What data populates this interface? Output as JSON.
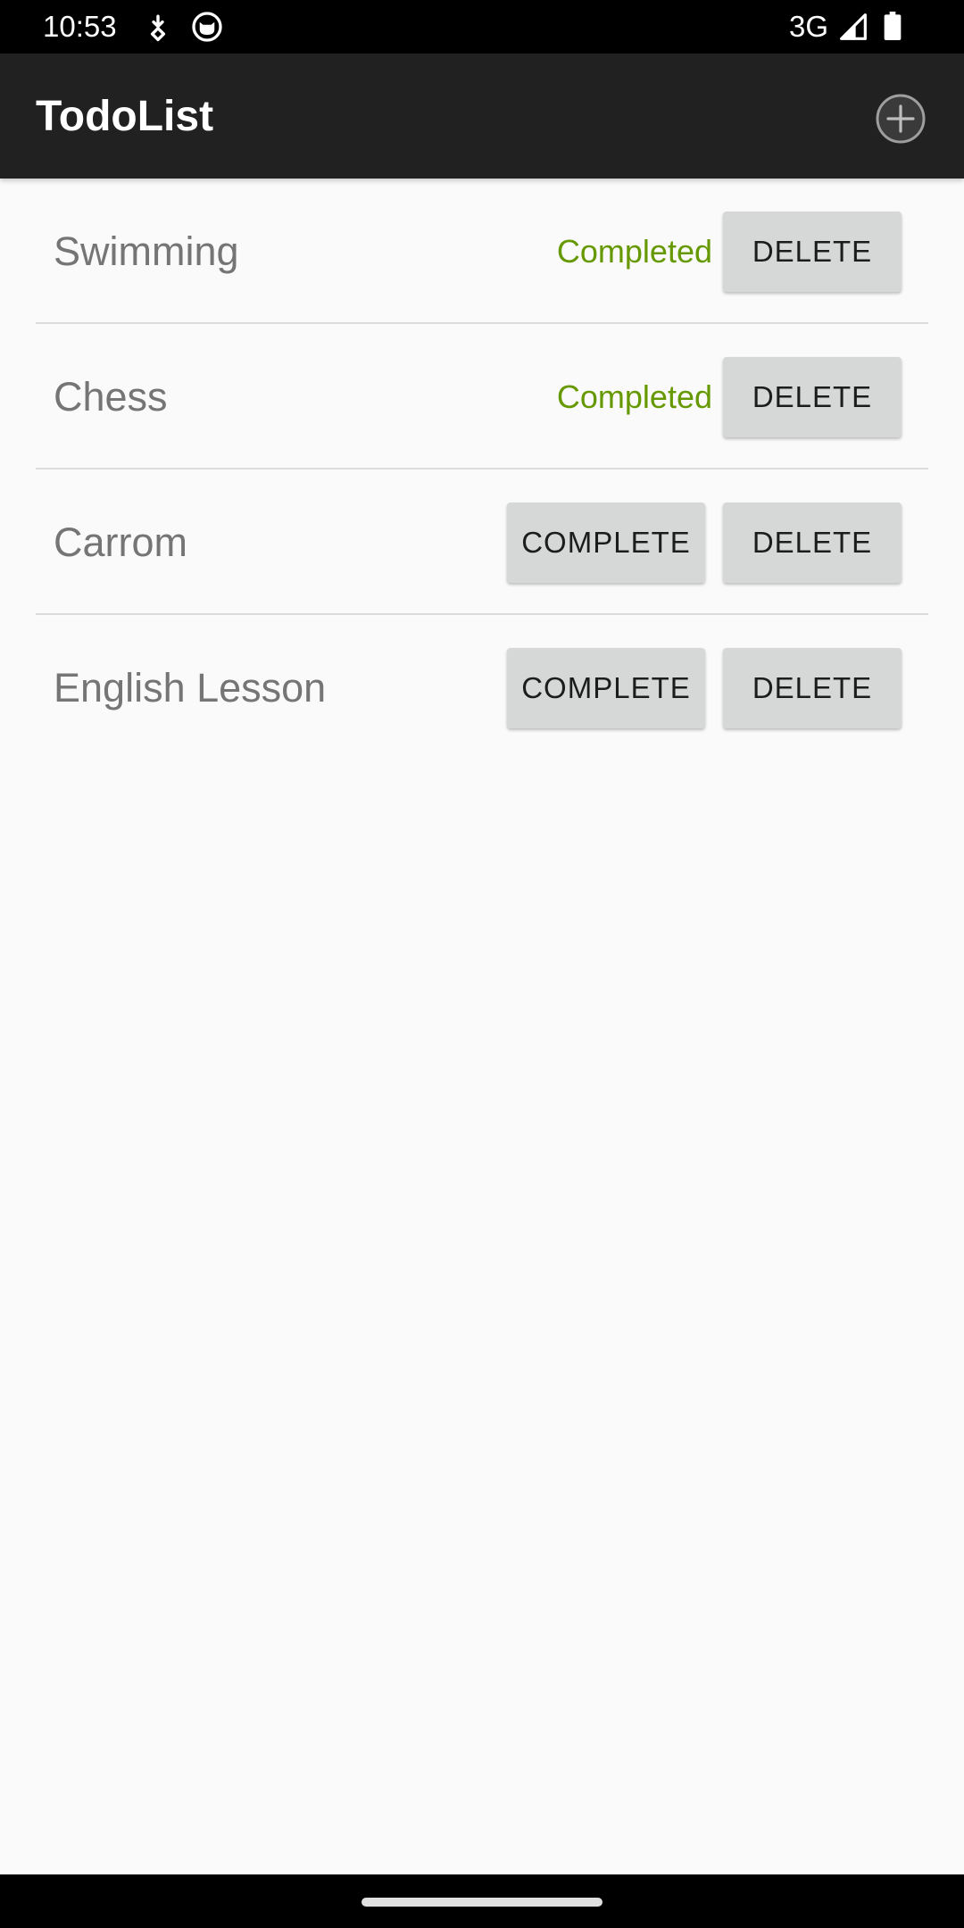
{
  "status_bar": {
    "time": "10:53",
    "network": "3G",
    "icons": [
      "download-notification-icon",
      "cat-face-notification-icon",
      "signal-icon",
      "battery-icon"
    ]
  },
  "app_bar": {
    "title": "TodoList",
    "add_icon": "add-circle-icon"
  },
  "todos": [
    {
      "name": "Swimming",
      "status_text": "Completed",
      "delete_label": "DELETE"
    },
    {
      "name": "Chess",
      "status_text": "Completed",
      "delete_label": "DELETE"
    },
    {
      "name": "Carrom",
      "complete_label": "COMPLETE",
      "delete_label": "DELETE"
    },
    {
      "name": "English Lesson",
      "complete_label": "COMPLETE",
      "delete_label": "DELETE"
    }
  ],
  "colors": {
    "app_bar": "#212121",
    "completed_text": "#669900",
    "button_bg": "#d6d7d7",
    "background": "#fafafa"
  }
}
